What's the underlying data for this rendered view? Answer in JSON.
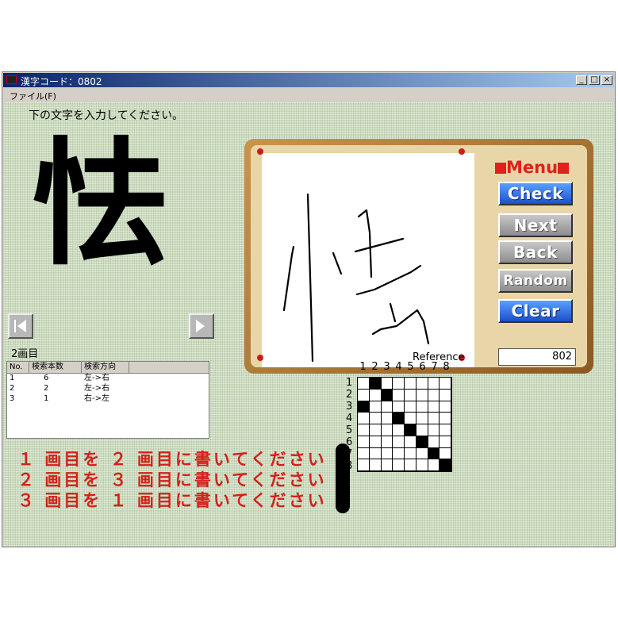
{
  "window": {
    "title": "漢字コード：0802",
    "min": "_",
    "max": "□",
    "close": "×"
  },
  "menubar": {
    "file": "ファイル(F)"
  },
  "prompt": "下の文字を入力してください。",
  "target_char": "怯",
  "nav": {
    "prev_icon": "left-arrow",
    "next_icon": "right-arrow"
  },
  "menu": {
    "title": "Menu",
    "check": "Check",
    "next": "Next",
    "back": "Back",
    "random": "Random",
    "clear": "Clear",
    "code_value": "802"
  },
  "stroke_label": "2画目",
  "table": {
    "headers": [
      "No.",
      "検索本数",
      "検索方向"
    ],
    "rows": [
      [
        "1",
        "6",
        "左->右"
      ],
      [
        "2",
        "2",
        "左->右"
      ],
      [
        "3",
        "1",
        "右->左"
      ]
    ]
  },
  "reference": {
    "title": "Reference",
    "cols": [
      "1",
      "2",
      "3",
      "4",
      "5",
      "6",
      "7",
      "8"
    ],
    "rows": [
      "1",
      "2",
      "3",
      "4",
      "5",
      "6",
      "7",
      "8"
    ],
    "filled": [
      [
        0,
        1
      ],
      [
        1,
        2
      ],
      [
        2,
        0
      ],
      [
        3,
        3
      ],
      [
        4,
        4
      ],
      [
        5,
        5
      ],
      [
        6,
        6
      ],
      [
        7,
        7
      ]
    ]
  },
  "messages": [
    "１ 画目を ２ 画目に書いてください",
    "２ 画目を ３ 画目に書いてください",
    "３ 画目を １ 画目に書いてください"
  ],
  "colors": {
    "accent_red": "#d4201a",
    "button_blue": "#1d4fc8",
    "title_blue": "#0a246a"
  }
}
